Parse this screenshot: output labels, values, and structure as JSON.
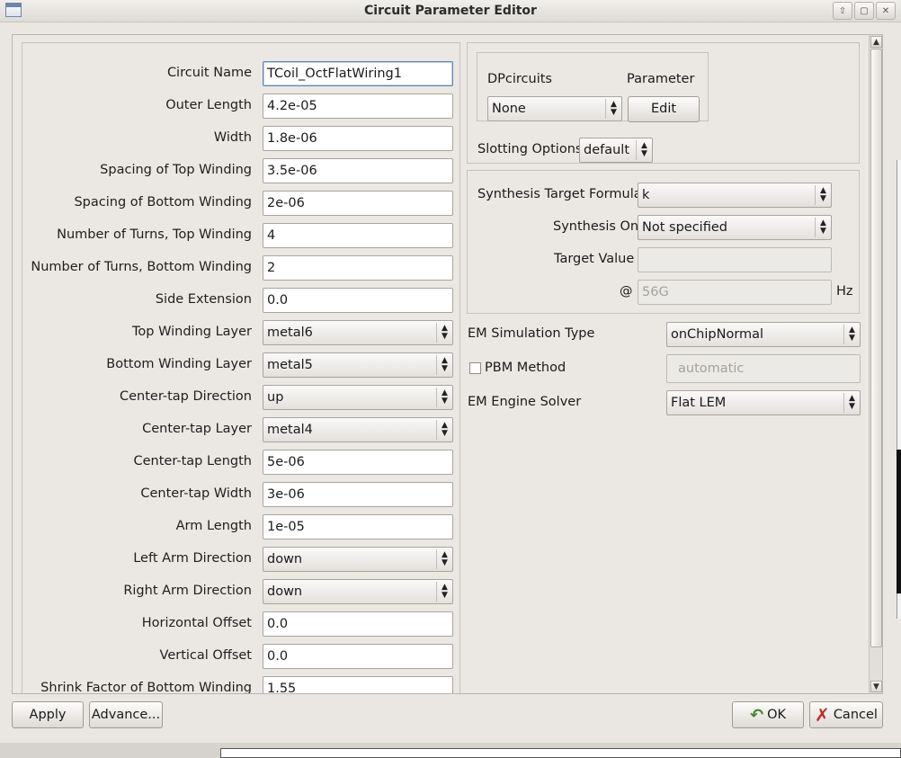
{
  "window": {
    "title": "Circuit Parameter Editor"
  },
  "left_fields": [
    {
      "label": "Circuit Name",
      "value": "TCoil_OctFlatWiring1",
      "kind": "text",
      "focused": true
    },
    {
      "label": "Outer Length",
      "value": "4.2e-05",
      "kind": "text"
    },
    {
      "label": "Width",
      "value": "1.8e-06",
      "kind": "text"
    },
    {
      "label": "Spacing of Top Winding",
      "value": "3.5e-06",
      "kind": "text"
    },
    {
      "label": "Spacing of Bottom Winding",
      "value": "2e-06",
      "kind": "text"
    },
    {
      "label": "Number of Turns, Top Winding",
      "value": "4",
      "kind": "text"
    },
    {
      "label": "Number of Turns, Bottom Winding",
      "value": "2",
      "kind": "text"
    },
    {
      "label": "Side Extension",
      "value": "0.0",
      "kind": "text"
    },
    {
      "label": "Top Winding Layer",
      "value": "metal6",
      "kind": "combo"
    },
    {
      "label": "Bottom Winding Layer",
      "value": "metal5",
      "kind": "combo"
    },
    {
      "label": "Center-tap Direction",
      "value": "up",
      "kind": "combo"
    },
    {
      "label": "Center-tap Layer",
      "value": "metal4",
      "kind": "combo"
    },
    {
      "label": "Center-tap Length",
      "value": "5e-06",
      "kind": "text"
    },
    {
      "label": "Center-tap Width",
      "value": "3e-06",
      "kind": "text"
    },
    {
      "label": "Arm Length",
      "value": "1e-05",
      "kind": "text"
    },
    {
      "label": "Left Arm Direction",
      "value": "down",
      "kind": "combo"
    },
    {
      "label": "Right Arm Direction",
      "value": "down",
      "kind": "combo"
    },
    {
      "label": "Horizontal Offset",
      "value": "0.0",
      "kind": "text"
    },
    {
      "label": "Vertical Offset",
      "value": "0.0",
      "kind": "text"
    },
    {
      "label": "Shrink Factor of Bottom Winding",
      "value": "1.55",
      "kind": "text"
    }
  ],
  "dp": {
    "circuits_label": "DPcircuits",
    "parameter_label": "Parameter",
    "circuits_value": "None",
    "edit_label": "Edit",
    "slotting_label": "Slotting Options",
    "slotting_value": "default"
  },
  "synthesis": {
    "formula_label": "Synthesis Target Formula",
    "formula_value": "k",
    "on_label": "Synthesis On",
    "on_value": "Not specified",
    "target_label": "Target Value",
    "target_value": "",
    "at_label": "@",
    "freq_value": "56G",
    "freq_unit": "Hz"
  },
  "em": {
    "sim_type_label": "EM Simulation Type",
    "sim_type_value": "onChipNormal",
    "pbm_label": "PBM Method",
    "pbm_value": "automatic",
    "solver_label": "EM Engine Solver",
    "solver_value": "Flat LEM"
  },
  "buttons": {
    "apply": "Apply",
    "advance": "Advance...",
    "ok": "OK",
    "cancel": "Cancel"
  }
}
